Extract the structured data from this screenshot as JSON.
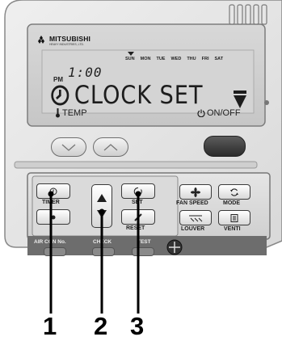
{
  "brand": {
    "name": "MITSUBISHI",
    "sub": "HEAVY INDUSTRIES, LTD."
  },
  "display": {
    "days": [
      "SUN",
      "MON",
      "TUE",
      "WED",
      "THU",
      "FRI",
      "SAT"
    ],
    "pm": "PM",
    "time": "1:00",
    "main_text": "CLOCK SET"
  },
  "labels": {
    "temp": "TEMP",
    "onoff": "ON/OFF"
  },
  "buttons": {
    "timer": "TIMER",
    "set": "SET",
    "reset": "RESET",
    "fan_speed": "FAN SPEED",
    "mode": "MODE",
    "louver": "LOUVER",
    "venti": "VENTI",
    "air_con_no": "AIR CON No.",
    "check": "CHECK",
    "test": "TEST"
  },
  "callouts": [
    "1",
    "2",
    "3"
  ]
}
